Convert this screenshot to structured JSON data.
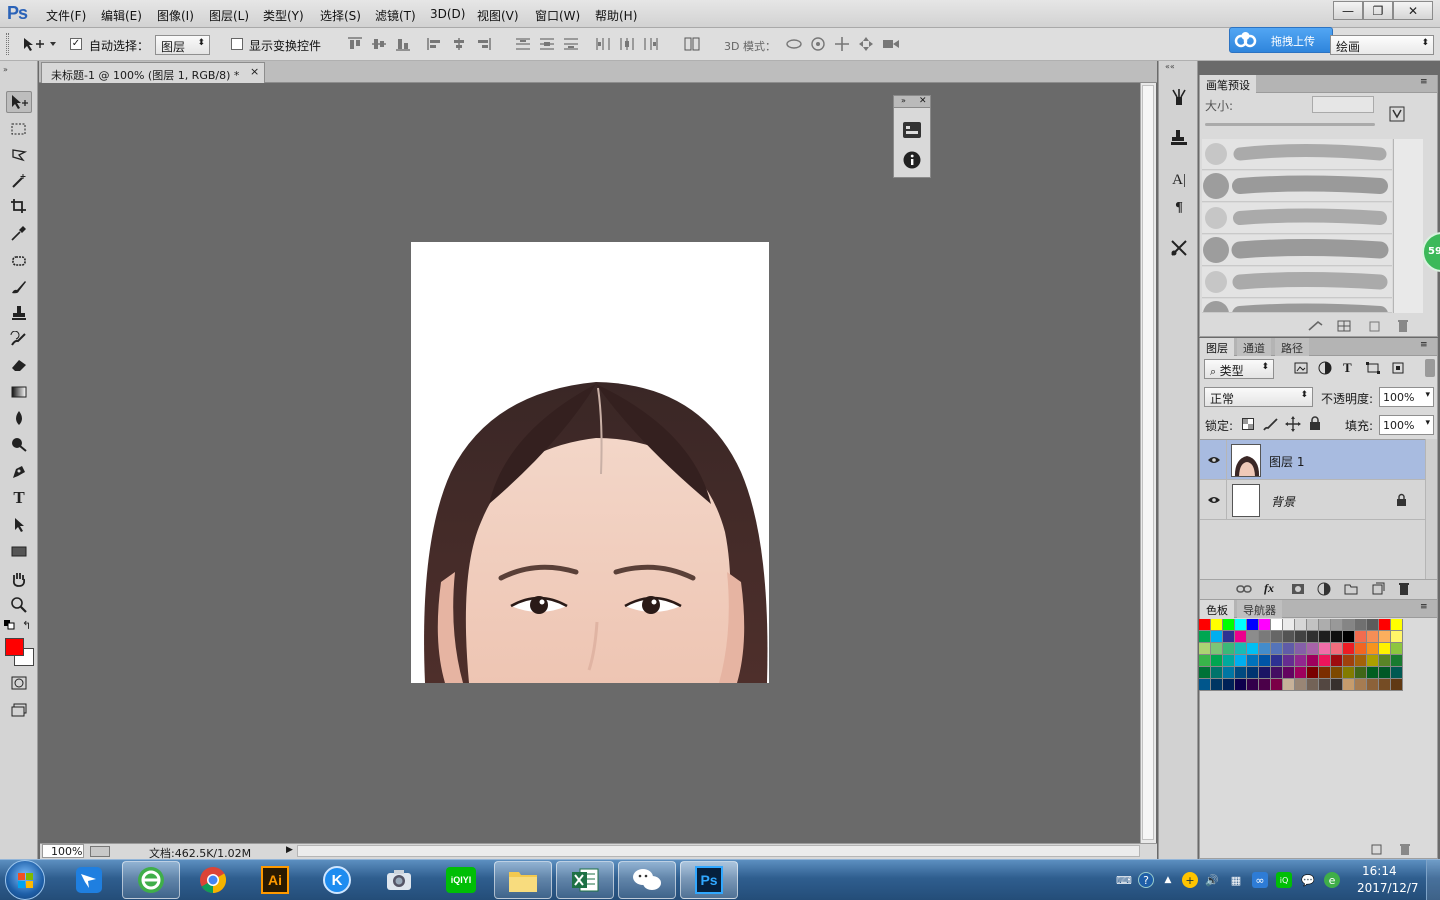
{
  "app": {
    "logo": "Ps"
  },
  "menu": [
    "文件(F)",
    "编辑(E)",
    "图像(I)",
    "图层(L)",
    "类型(Y)",
    "选择(S)",
    "滤镜(T)",
    "3D(D)",
    "视图(V)",
    "窗口(W)",
    "帮助(H)"
  ],
  "window_controls": {
    "minimize": "—",
    "maximize": "❐",
    "close": "✕"
  },
  "options": {
    "auto_select_label": "自动选择：",
    "auto_select_checked": true,
    "auto_select_target": "图层",
    "show_transform_label": "显示变换控件",
    "show_transform_checked": false,
    "mode_3d_label": "3D 模式：",
    "workspace": "绘画"
  },
  "cloud": {
    "label": "拖拽上传"
  },
  "document": {
    "tab_title": "未标题-1 @ 100% (图层 1, RGB/8) *",
    "tab_close": "×"
  },
  "status": {
    "zoom": "100%",
    "doc_info": "文档:462.5K/1.02M"
  },
  "brush_panel": {
    "title": "画笔预设",
    "size_label": "大小:"
  },
  "layers_panel": {
    "tabs": [
      "图层",
      "通道",
      "路径"
    ],
    "filter_kind": "类型",
    "blend_mode": "正常",
    "opacity_label": "不透明度:",
    "opacity": "100%",
    "lock_label": "锁定:",
    "fill_label": "填充:",
    "fill": "100%",
    "layers": [
      {
        "name": "图层 1",
        "selected": true,
        "visible": true
      },
      {
        "name": "背景",
        "selected": false,
        "visible": true,
        "locked": true
      }
    ]
  },
  "swatches_panel": {
    "tabs": [
      "色板",
      "导航器"
    ],
    "rows": [
      [
        "#ff0000",
        "#ffff00",
        "#00ff00",
        "#00ffff",
        "#0000ff",
        "#ff00ff",
        "#ffffff",
        "#ebebeb",
        "#d6d6d6",
        "#c2c2c2",
        "#adadad",
        "#999999",
        "#858585",
        "#707070",
        "#5c5c5c",
        "#ff0000",
        "#ffff00"
      ],
      [
        "#00a651",
        "#00aeef",
        "#2e3192",
        "#ec008c",
        "#8c8c8c",
        "#7a7a7a",
        "#666666",
        "#545454",
        "#424242",
        "#303030",
        "#1f1f1f",
        "#0f0f0f",
        "#000000",
        "#f26c4f",
        "#f68e56",
        "#fbaf5d",
        "#fff568"
      ],
      [
        "#acd373",
        "#7cc576",
        "#3bb878",
        "#1abbb4",
        "#00bff3",
        "#438ccb",
        "#5574b9",
        "#605ca8",
        "#855fa8",
        "#a763a8",
        "#f06ea9",
        "#f26d7d",
        "#ed1c24",
        "#f26522",
        "#f7941d",
        "#fff200",
        "#8dc63f"
      ],
      [
        "#39b54a",
        "#00a651",
        "#00a99d",
        "#00aeef",
        "#0072bc",
        "#0054a6",
        "#2e3192",
        "#662d91",
        "#92278f",
        "#9e005d",
        "#ed145b",
        "#9e0b0f",
        "#a0410d",
        "#a3620a",
        "#aba000",
        "#598527",
        "#197b30"
      ],
      [
        "#007236",
        "#00746b",
        "#0076a3",
        "#004a80",
        "#003471",
        "#1b1464",
        "#440e62",
        "#630460",
        "#9e005d",
        "#790000",
        "#7b2e00",
        "#7d4900",
        "#827b00",
        "#406618",
        "#005e20",
        "#005826",
        "#005952"
      ],
      [
        "#00568c",
        "#003663",
        "#002157",
        "#0d004c",
        "#32004b",
        "#4b0049",
        "#7b0046",
        "#c7b299",
        "#998675",
        "#736357",
        "#534741",
        "#37302d",
        "#c69c6d",
        "#a67c52",
        "#8c6239",
        "#754c24",
        "#603913"
      ]
    ]
  },
  "colors": {
    "foreground": "#ff0000",
    "background": "#ffffff",
    "selected_layer": "#a8bbe0"
  },
  "taskbar": {
    "apps": [
      "start-orb",
      "feishu",
      "360-browser",
      "chrome",
      "illustrator",
      "kugou",
      "qq-photo",
      "iqiyi",
      "file-explorer",
      "excel",
      "wechat",
      "photoshop"
    ],
    "illustrator_label": "Ai",
    "kugou_label": "K",
    "iqiyi_label": "iQIYI",
    "photoshop_label": "Ps",
    "clock_time": "16:14",
    "clock_date": "2017/12/7",
    "badge": "59"
  }
}
